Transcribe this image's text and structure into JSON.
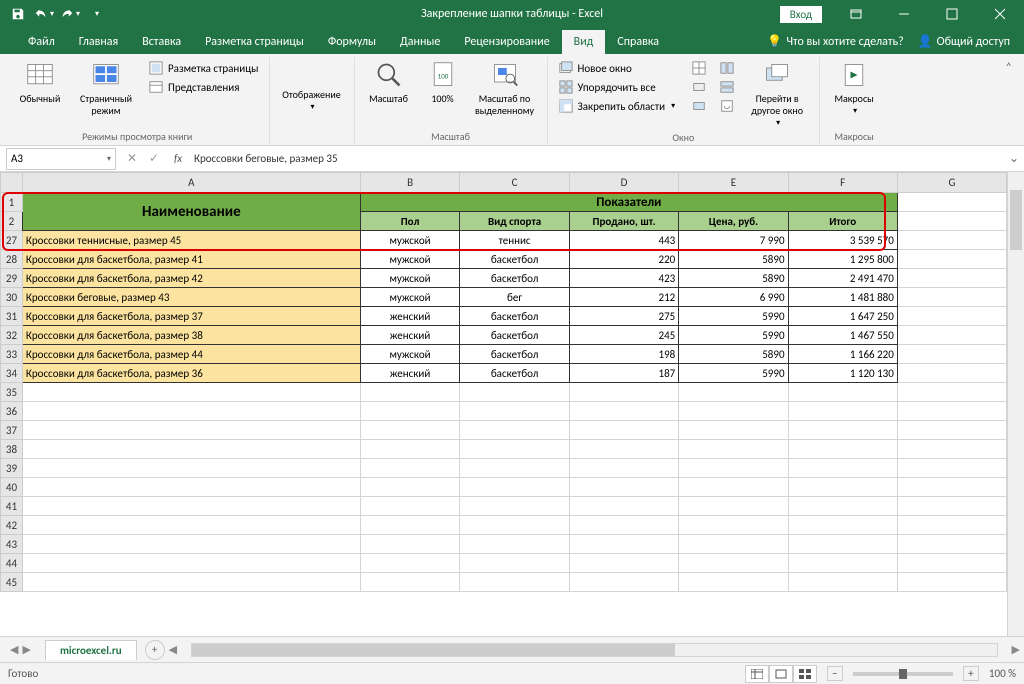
{
  "titlebar": {
    "title": "Закрепление шапки таблицы - Excel",
    "login": "Вход"
  },
  "menu": {
    "tabs": [
      "Файл",
      "Главная",
      "Вставка",
      "Разметка страницы",
      "Формулы",
      "Данные",
      "Рецензирование",
      "Вид",
      "Справка"
    ],
    "active": 7,
    "tell_me": "Что вы хотите сделать?",
    "share": "Общий доступ"
  },
  "ribbon": {
    "views": {
      "normal": "Обычный",
      "page_break": "Страничный режим",
      "page_layout": "Разметка страницы",
      "custom_views": "Представления",
      "group": "Режимы просмотра книги"
    },
    "show": {
      "label": "Отображение"
    },
    "zoom": {
      "zoom": "Масштаб",
      "hundred": "100%",
      "selection": "Масштаб по выделенному",
      "group": "Масштаб"
    },
    "window": {
      "new": "Новое окно",
      "arrange": "Упорядочить все",
      "freeze": "Закрепить области",
      "switch": "Перейти в другое окно",
      "group": "Окно"
    },
    "macros": {
      "label": "Макросы",
      "group": "Макросы"
    }
  },
  "namebox": "A3",
  "formula": "Кроссовки беговые, размер 35",
  "columns": [
    "A",
    "B",
    "C",
    "D",
    "E",
    "F",
    "G"
  ],
  "header_rows": [
    1,
    2
  ],
  "data_row_nums": [
    27,
    28,
    29,
    30,
    31,
    32,
    33,
    34
  ],
  "blank_row_nums": [
    35,
    36,
    37,
    38,
    39,
    40,
    41,
    42,
    43,
    44,
    45
  ],
  "table_header": {
    "name": "Наименование",
    "metrics": "Показатели",
    "sex": "Пол",
    "sport": "Вид спорта",
    "sold": "Продано, шт.",
    "price": "Цена, руб.",
    "total": "Итого"
  },
  "rows": [
    {
      "name": "Кроссовки теннисные, размер 45",
      "sex": "мужской",
      "sport": "теннис",
      "sold": "443",
      "price": "7 990",
      "total": "3 539 570"
    },
    {
      "name": "Кроссовки для баскетбола, размер 41",
      "sex": "мужской",
      "sport": "баскетбол",
      "sold": "220",
      "price": "5890",
      "total": "1 295 800"
    },
    {
      "name": "Кроссовки для баскетбола, размер 42",
      "sex": "мужской",
      "sport": "баскетбол",
      "sold": "423",
      "price": "5890",
      "total": "2 491 470"
    },
    {
      "name": "Кроссовки беговые, размер 43",
      "sex": "мужской",
      "sport": "бег",
      "sold": "212",
      "price": "6 990",
      "total": "1 481 880"
    },
    {
      "name": "Кроссовки для баскетбола, размер 37",
      "sex": "женский",
      "sport": "баскетбол",
      "sold": "275",
      "price": "5990",
      "total": "1 647 250"
    },
    {
      "name": "Кроссовки для баскетбола, размер 38",
      "sex": "женский",
      "sport": "баскетбол",
      "sold": "245",
      "price": "5990",
      "total": "1 467 550"
    },
    {
      "name": "Кроссовки для баскетбола, размер 44",
      "sex": "мужской",
      "sport": "баскетбол",
      "sold": "198",
      "price": "5890",
      "total": "1 166 220"
    },
    {
      "name": "Кроссовки для баскетбола, размер 36",
      "sex": "женский",
      "sport": "баскетбол",
      "sold": "187",
      "price": "5990",
      "total": "1 120 130"
    }
  ],
  "sheet_tab": "microexcel.ru",
  "status": {
    "ready": "Готово",
    "zoom": "100 %"
  }
}
